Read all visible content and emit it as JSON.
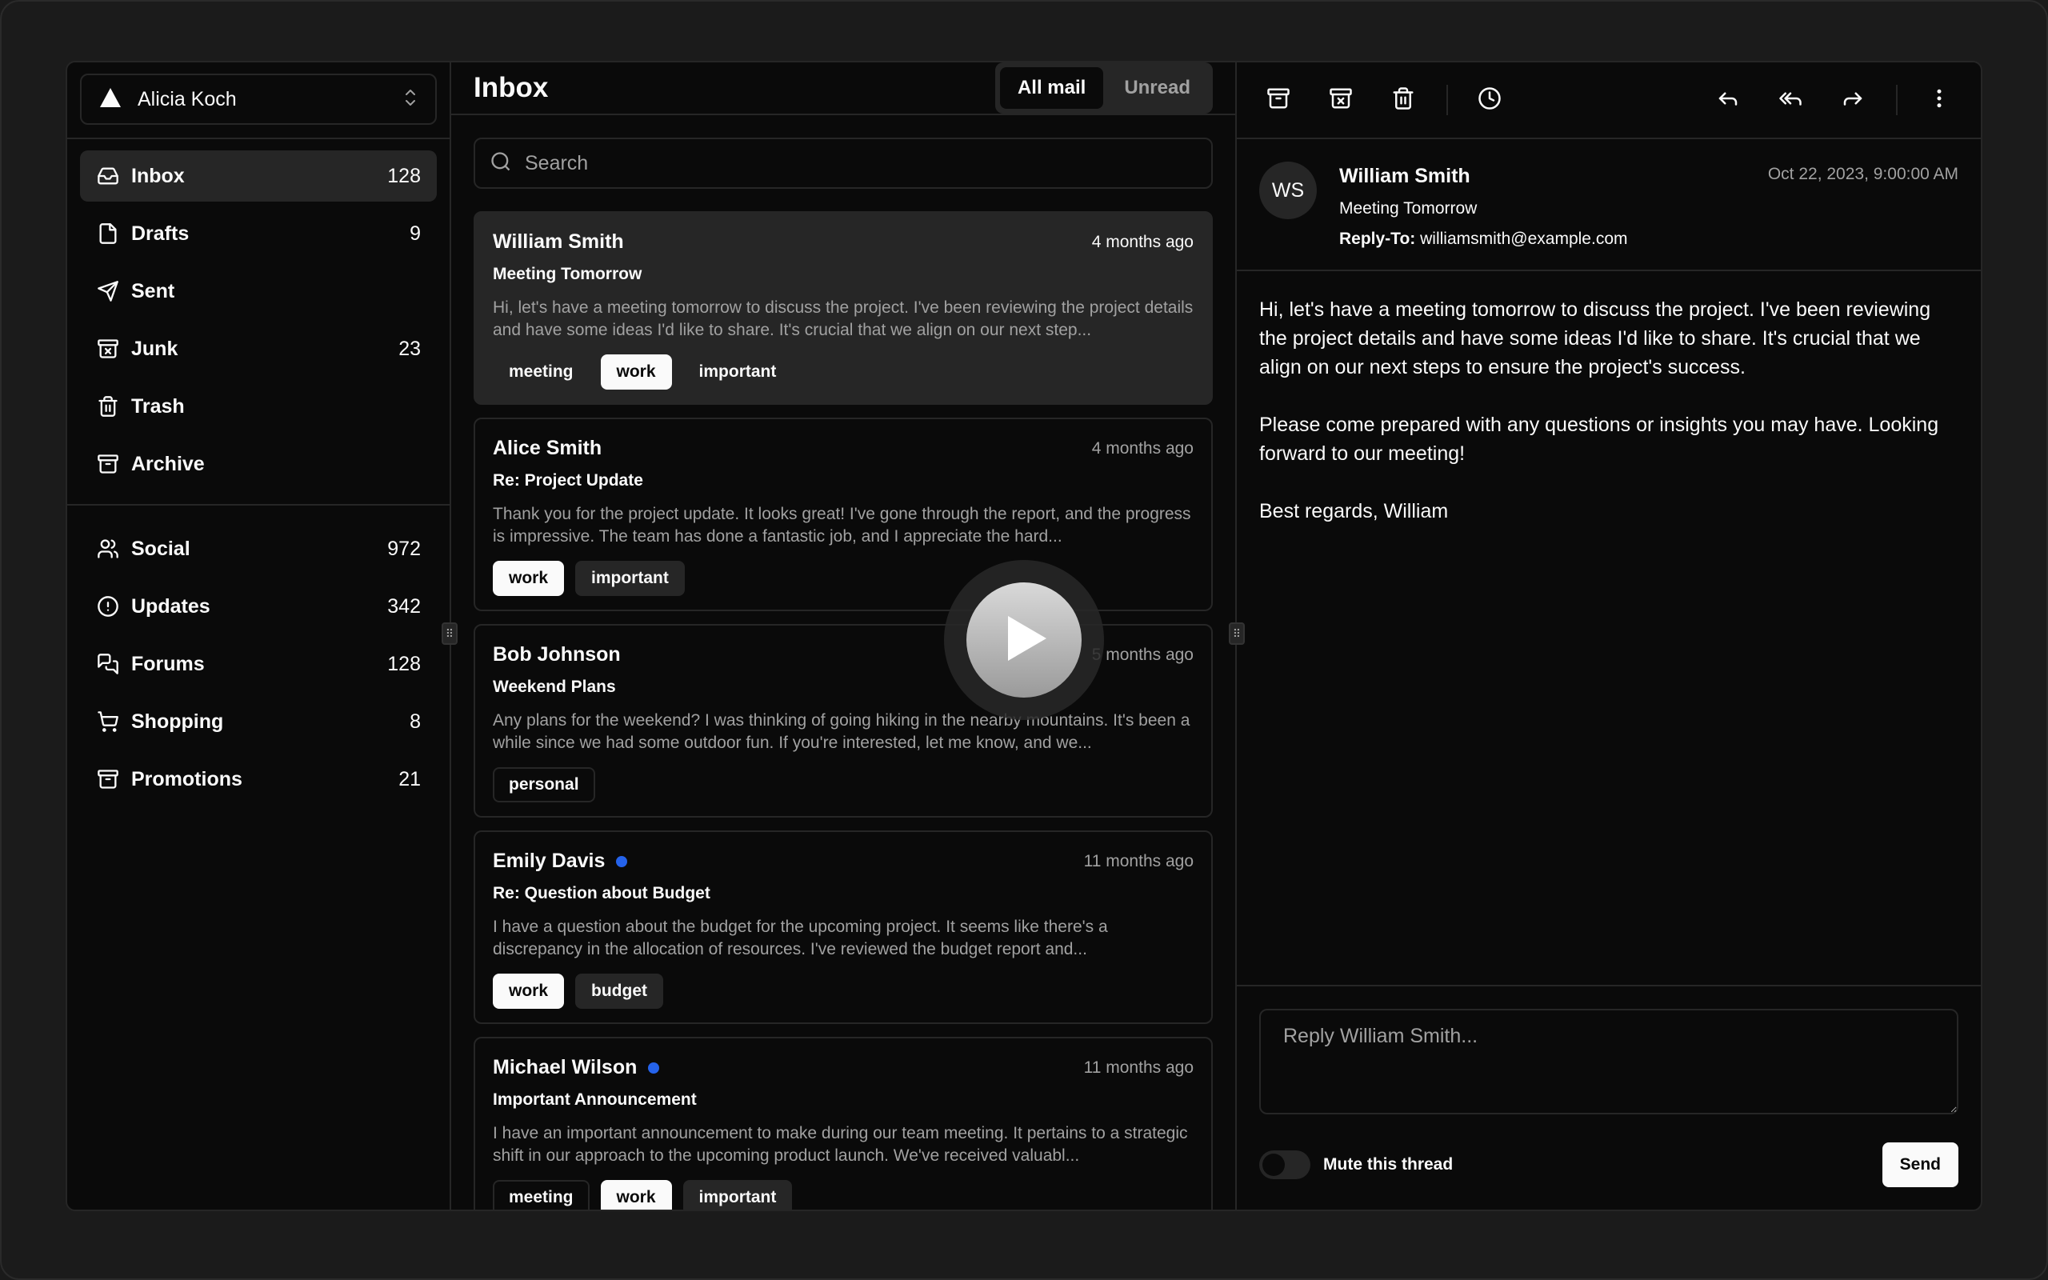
{
  "account": {
    "name": "Alicia Koch"
  },
  "nav_primary": [
    {
      "label": "Inbox",
      "count": "128",
      "icon": "inbox-icon",
      "active": true
    },
    {
      "label": "Drafts",
      "count": "9",
      "icon": "file-icon"
    },
    {
      "label": "Sent",
      "count": "",
      "icon": "send-icon"
    },
    {
      "label": "Junk",
      "count": "23",
      "icon": "archive-x-icon"
    },
    {
      "label": "Trash",
      "count": "",
      "icon": "trash-icon"
    },
    {
      "label": "Archive",
      "count": "",
      "icon": "archive-icon"
    }
  ],
  "nav_secondary": [
    {
      "label": "Social",
      "count": "972",
      "icon": "users-icon"
    },
    {
      "label": "Updates",
      "count": "342",
      "icon": "alert-circle-icon"
    },
    {
      "label": "Forums",
      "count": "128",
      "icon": "messages-icon"
    },
    {
      "label": "Shopping",
      "count": "8",
      "icon": "cart-icon"
    },
    {
      "label": "Promotions",
      "count": "21",
      "icon": "archive-icon"
    }
  ],
  "list": {
    "title": "Inbox",
    "tabs": {
      "all": "All mail",
      "unread": "Unread"
    },
    "search_placeholder": "Search"
  },
  "mails": [
    {
      "name": "William Smith",
      "date": "4 months ago",
      "subject": "Meeting Tomorrow",
      "unread": false,
      "selected": true,
      "preview": "Hi, let's have a meeting tomorrow to discuss the project. I've been reviewing the project details and have some ideas I'd like to share. It's crucial that we align on our next step...",
      "labels": [
        {
          "text": "meeting",
          "variant": "plain"
        },
        {
          "text": "work",
          "variant": "primary"
        },
        {
          "text": "important",
          "variant": "plain"
        }
      ]
    },
    {
      "name": "Alice Smith",
      "date": "4 months ago",
      "subject": "Re: Project Update",
      "unread": false,
      "preview": "Thank you for the project update. It looks great! I've gone through the report, and the progress is impressive. The team has done a fantastic job, and I appreciate the hard...",
      "labels": [
        {
          "text": "work",
          "variant": "primary"
        },
        {
          "text": "important",
          "variant": "secondary"
        }
      ]
    },
    {
      "name": "Bob Johnson",
      "date": "5 months ago",
      "subject": "Weekend Plans",
      "unread": false,
      "preview": "Any plans for the weekend? I was thinking of going hiking in the nearby mountains. It's been a while since we had some outdoor fun. If you're interested, let me know, and we...",
      "labels": [
        {
          "text": "personal",
          "variant": "outline"
        }
      ]
    },
    {
      "name": "Emily Davis",
      "date": "11 months ago",
      "subject": "Re: Question about Budget",
      "unread": true,
      "preview": "I have a question about the budget for the upcoming project. It seems like there's a discrepancy in the allocation of resources. I've reviewed the budget report and...",
      "labels": [
        {
          "text": "work",
          "variant": "primary"
        },
        {
          "text": "budget",
          "variant": "secondary"
        }
      ]
    },
    {
      "name": "Michael Wilson",
      "date": "11 months ago",
      "subject": "Important Announcement",
      "unread": true,
      "preview": "I have an important announcement to make during our team meeting. It pertains to a strategic shift in our approach to the upcoming product launch. We've received valuabl...",
      "labels": [
        {
          "text": "meeting",
          "variant": "outline"
        },
        {
          "text": "work",
          "variant": "primary"
        },
        {
          "text": "important",
          "variant": "secondary"
        }
      ]
    }
  ],
  "display": {
    "avatar_initials": "WS",
    "from": "William Smith",
    "subject": "Meeting Tomorrow",
    "reply_to_label": "Reply-To:",
    "reply_to": "williamsmith@example.com",
    "date": "Oct 22, 2023, 9:00:00 AM",
    "body": "Hi, let's have a meeting tomorrow to discuss the project. I've been reviewing the project details and have some ideas I'd like to share. It's crucial that we align on our next steps to ensure the project's success.\n\nPlease come prepared with any questions or insights you may have. Looking forward to our meeting!\n\nBest regards, William",
    "reply_placeholder": "Reply William Smith...",
    "mute_label": "Mute this thread",
    "send_label": "Send"
  },
  "colors": {
    "background": "#0a0a0a",
    "border": "#262626",
    "accent_dot": "#2563eb",
    "muted_text": "#a1a1a1"
  }
}
